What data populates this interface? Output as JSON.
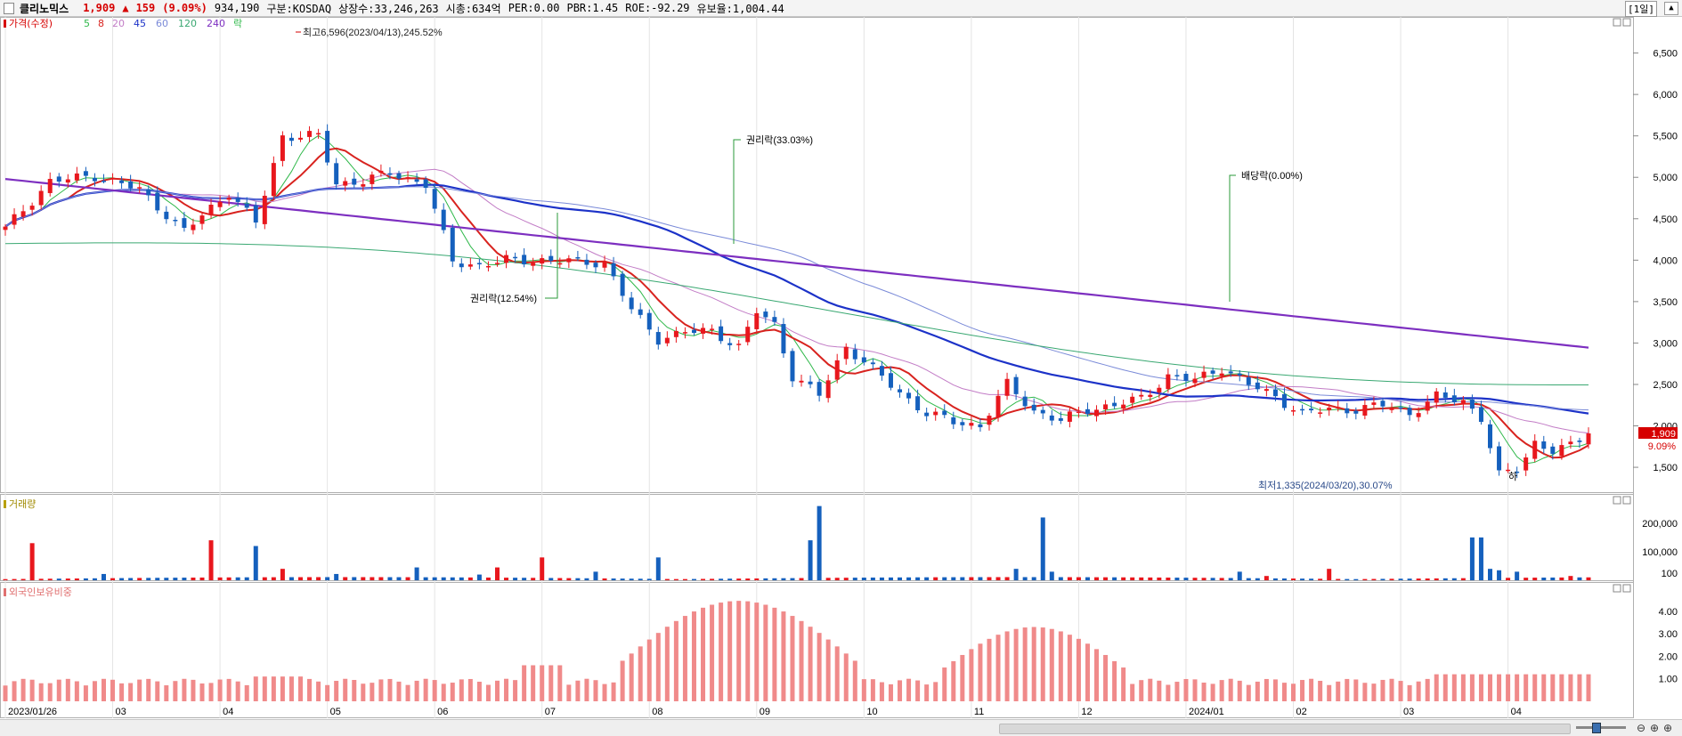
{
  "header": {
    "name": "클리노믹스",
    "price": "1,909",
    "arrow": "▲",
    "change": "159",
    "change_pct": "(9.09%)",
    "volume": "934,190",
    "market": "구분:KOSDAQ",
    "shares": "상장수:33,246,263",
    "mcap": "시총:634억",
    "per": "PER:0.00",
    "pbr": "PBR:1.45",
    "roe": "ROE:-92.29",
    "reserve": "유보율:1,004.44",
    "period": "[1일]"
  },
  "legend": {
    "price": "가격(수정)",
    "ma": [
      "5",
      "8",
      "20",
      "45",
      "60",
      "120",
      "240"
    ],
    "ex": "락",
    "volume": "거래량",
    "foreign": "외국인보유비중"
  },
  "colors": {
    "up": "#e8171d",
    "down": "#1560bd",
    "ma5": "#2fb84a",
    "ma8": "#d8231f",
    "ma20": "#c27cc6",
    "ma45": "#1c32c8",
    "ma60": "#7a8ad8",
    "ma120": "#3aa872",
    "ma240": "#7d2fc0",
    "foreign": "#f08a8a"
  },
  "chart_data": [
    {
      "type": "candlestick",
      "title": "클리노믹스",
      "ylim": [
        1200,
        6850
      ],
      "y_ticks": [
        "1,500",
        "2,000",
        "2,500",
        "3,000",
        "3,500",
        "4,000",
        "4,500",
        "5,000",
        "5,500",
        "6,000",
        "6,500"
      ],
      "x_ticks": [
        "2023/01/26",
        "03",
        "04",
        "05",
        "06",
        "07",
        "08",
        "09",
        "10",
        "11",
        "12",
        "2024/01",
        "02",
        "03",
        "04"
      ],
      "last_price": "1,909",
      "last_change": "9.09%",
      "annotations": {
        "high": "최고6,596(2023/04/13),245.52%",
        "low": "최저1,335(2024/03/20),30.07%",
        "rights1": "권리락(12.54%)",
        "rights2": "권리락(33.03%)",
        "dividend": "배당락(0.00%)",
        "limit_down": "하"
      },
      "close_anchors": [
        [
          0,
          4380
        ],
        [
          5,
          4950
        ],
        [
          10,
          5020
        ],
        [
          15,
          4850
        ],
        [
          20,
          4350
        ],
        [
          25,
          4820
        ],
        [
          28,
          4450
        ],
        [
          31,
          5500
        ],
        [
          35,
          5500
        ],
        [
          37,
          4920
        ],
        [
          40,
          4960
        ],
        [
          43,
          5050
        ],
        [
          47,
          4920
        ],
        [
          50,
          3980
        ],
        [
          53,
          3940
        ],
        [
          56,
          4000
        ],
        [
          60,
          4000
        ],
        [
          64,
          3980
        ],
        [
          67,
          3970
        ],
        [
          70,
          3400
        ],
        [
          73,
          3050
        ],
        [
          76,
          3130
        ],
        [
          79,
          3150
        ],
        [
          82,
          2950
        ],
        [
          84,
          3380
        ],
        [
          86,
          3220
        ],
        [
          88,
          2600
        ],
        [
          91,
          2370
        ],
        [
          94,
          2960
        ],
        [
          97,
          2680
        ],
        [
          100,
          2400
        ],
        [
          103,
          2150
        ],
        [
          106,
          2050
        ],
        [
          109,
          2000
        ],
        [
          112,
          2500
        ],
        [
          115,
          2180
        ],
        [
          118,
          2060
        ],
        [
          121,
          2200
        ],
        [
          124,
          2250
        ],
        [
          127,
          2330
        ],
        [
          130,
          2600
        ],
        [
          133,
          2550
        ],
        [
          136,
          2700
        ],
        [
          139,
          2500
        ],
        [
          142,
          2350
        ],
        [
          145,
          2150
        ],
        [
          148,
          2200
        ],
        [
          151,
          2200
        ],
        [
          154,
          2250
        ],
        [
          157,
          2150
        ],
        [
          160,
          2350
        ],
        [
          163,
          2300
        ],
        [
          165,
          2100
        ],
        [
          167,
          1400
        ],
        [
          169,
          1470
        ],
        [
          171,
          1800
        ],
        [
          173,
          1700
        ],
        [
          175,
          1750
        ],
        [
          177,
          1909
        ]
      ],
      "ma_visible": [
        "5",
        "8",
        "20",
        "45",
        "60",
        "120",
        "240"
      ],
      "volume": {
        "y_ticks": [
          "200,000",
          "100,000",
          "100"
        ],
        "spikes": [
          [
            3,
            130000
          ],
          [
            11,
            22000
          ],
          [
            23,
            140000
          ],
          [
            28,
            120000
          ],
          [
            31,
            40000
          ],
          [
            37,
            22000
          ],
          [
            46,
            45000
          ],
          [
            53,
            20000
          ],
          [
            55,
            45000
          ],
          [
            60,
            80000
          ],
          [
            66,
            30000
          ],
          [
            73,
            80000
          ],
          [
            90,
            140000
          ],
          [
            91,
            260000
          ],
          [
            113,
            40000
          ],
          [
            116,
            220000
          ],
          [
            117,
            30000
          ],
          [
            138,
            30000
          ],
          [
            141,
            15000
          ],
          [
            148,
            40000
          ],
          [
            164,
            150000
          ],
          [
            165,
            150000
          ],
          [
            166,
            40000
          ],
          [
            167,
            35000
          ],
          [
            169,
            30000
          ],
          [
            175,
            15000
          ]
        ]
      },
      "foreign_ratio": {
        "y_ticks": [
          "4.00",
          "3.00",
          "2.00",
          "1.00"
        ],
        "ylim": [
          0,
          4.9
        ]
      }
    }
  ]
}
